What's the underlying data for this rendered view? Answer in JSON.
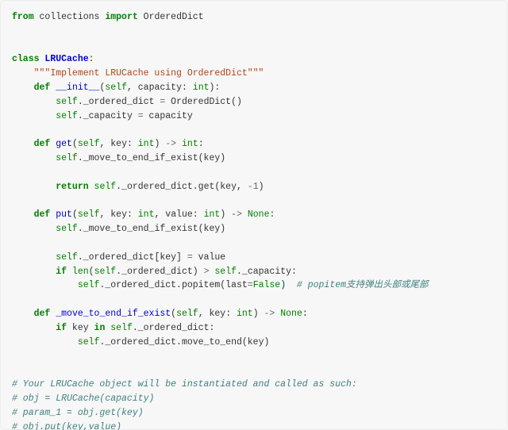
{
  "code": {
    "l01": {
      "kw_from": "from",
      "mod": "collections",
      "kw_import": "import",
      "name": "OrderedDict"
    },
    "l04": {
      "kw_class": "class",
      "cls": "LRUCache",
      "colon": ":"
    },
    "l05": {
      "doc": "\"\"\"Implement LRUCache using OrderedDict\"\"\""
    },
    "l06": {
      "kw_def": "def",
      "fn": "__init__",
      "lp": "(",
      "self": "self",
      "c1": ", capacity: ",
      "t1": "int",
      "rp": "):"
    },
    "l07": {
      "self": "self",
      "rest": "._ordered_dict ",
      "eq": "=",
      "sp": " OrderedDict()"
    },
    "l08": {
      "self": "self",
      "rest": "._capacity ",
      "eq": "=",
      "sp": " capacity"
    },
    "l10": {
      "kw_def": "def",
      "fn": "get",
      "lp": "(",
      "self": "self",
      "c1": ", key: ",
      "t1": "int",
      "ar1": ") ",
      "arrow": "->",
      "sp": " ",
      "t2": "int",
      "colon": ":"
    },
    "l11": {
      "self": "self",
      "rest": "._move_to_end_if_exist(key)"
    },
    "l13": {
      "kw_ret": "return",
      "sp": " ",
      "self": "self",
      "rest": "._ordered_dict.get(key, ",
      "neg": "-",
      "num": "1",
      "rp": ")"
    },
    "l15": {
      "kw_def": "def",
      "fn": "put",
      "lp": "(",
      "self": "self",
      "c1": ", key: ",
      "t1": "int",
      "c2": ", value: ",
      "t2": "int",
      "ar1": ") ",
      "arrow": "->",
      "sp": " ",
      "t3": "None",
      "colon": ":"
    },
    "l16": {
      "self": "self",
      "rest": "._move_to_end_if_exist(key)"
    },
    "l18": {
      "self": "self",
      "rest": "._ordered_dict[key] ",
      "eq": "=",
      "sp": " value"
    },
    "l19": {
      "kw_if": "if",
      "sp1": " ",
      "bi": "len",
      "lp": "(",
      "self": "self",
      "mid": "._ordered_dict) ",
      "gt": ">",
      "sp2": " ",
      "self2": "self",
      "rest": "._capacity:"
    },
    "l20": {
      "self": "self",
      "rest1": "._ordered_dict.popitem(last",
      "eq": "=",
      "val": "False",
      "rp": ")  ",
      "cmt": "# popitem支持弹出头部或尾部"
    },
    "l22": {
      "kw_def": "def",
      "fn": "_move_to_end_if_exist",
      "lp": "(",
      "self": "self",
      "c1": ", key: ",
      "t1": "int",
      "ar1": ") ",
      "arrow": "->",
      "sp": " ",
      "t2": "None",
      "colon": ":"
    },
    "l23": {
      "kw_if": "if",
      "mid": " key ",
      "kw_in": "in",
      "sp": " ",
      "self": "self",
      "rest": "._ordered_dict:"
    },
    "l24": {
      "self": "self",
      "rest": "._ordered_dict.move_to_end(key)"
    },
    "l27": {
      "cmt": "# Your LRUCache object will be instantiated and called as such:"
    },
    "l28": {
      "cmt": "# obj = LRUCache(capacity)"
    },
    "l29": {
      "cmt": "# param_1 = obj.get(key)"
    },
    "l30": {
      "cmt": "# obj.put(key,value)"
    }
  }
}
